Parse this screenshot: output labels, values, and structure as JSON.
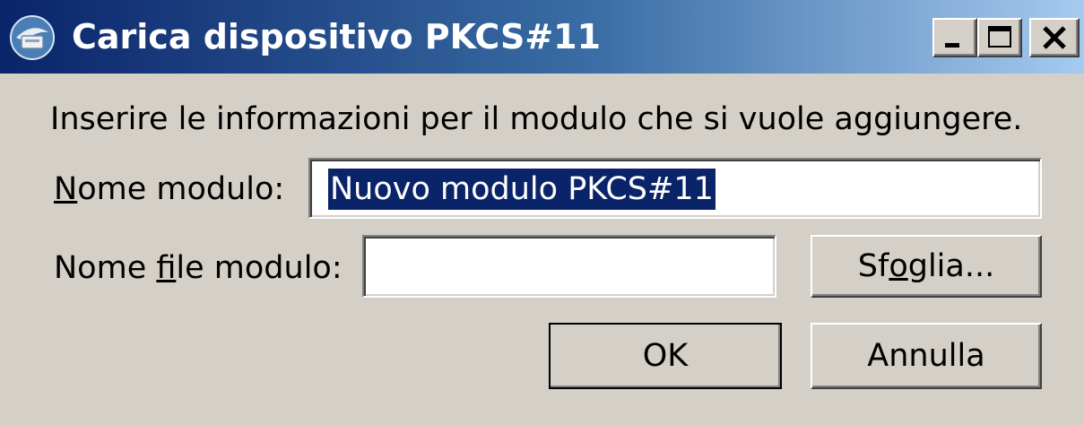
{
  "window": {
    "title": "Carica dispositivo PKCS#11",
    "controls": {
      "minimize": "minimize",
      "maximize": "maximize",
      "close": "close"
    }
  },
  "dialog": {
    "instructions": "Inserire le informazioni per il modulo che si vuole aggiungere.",
    "module_name": {
      "label_accel": "N",
      "label_rest": "ome modulo:",
      "value": "Nuovo modulo PKCS#11"
    },
    "module_file": {
      "label_pre": "Nome ",
      "label_accel": "f",
      "label_rest": "ile modulo:",
      "value": ""
    },
    "buttons": {
      "browse_pre": "Sf",
      "browse_accel": "o",
      "browse_rest": "glia...",
      "ok": "OK",
      "cancel": "Annulla"
    }
  },
  "colors": {
    "title_gradient_start": "#0a246a",
    "title_gradient_end": "#a6caf0",
    "dialog_bg": "#d4d0c8",
    "selection": "#0a246a"
  }
}
